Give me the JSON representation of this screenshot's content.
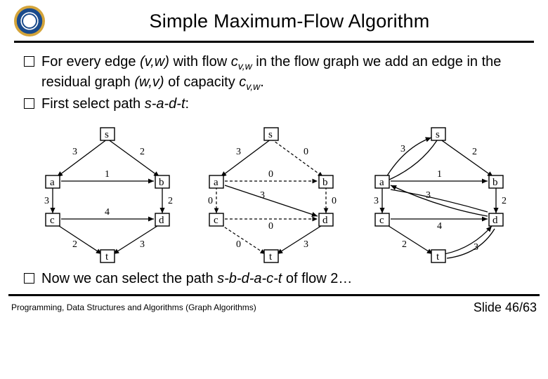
{
  "header": {
    "title": "Simple Maximum-Flow Algorithm"
  },
  "bullets": {
    "b1a": "For every edge ",
    "b1_vw": "(v,w)",
    "b1b": " with flow ",
    "b1_c1": "c",
    "b1_c1sub": "v,w",
    "b1c": " in the flow graph we add an edge in the residual graph ",
    "b1_wv": "(w,v)",
    "b1d": " of capacity ",
    "b1_c2": "c",
    "b1_c2sub": "v,w",
    "b1e": ".",
    "b2a": "First select path ",
    "b2_path": "s-a-d-t",
    "b2b": ":",
    "b3a": "Now we can select the path ",
    "b3_path": "s-b-d-a-c-t",
    "b3b": " of flow 2…"
  },
  "footer": {
    "left": "Programming, Data Structures and Algorithms  (Graph Algorithms)",
    "right_label": "Slide ",
    "right_page": "46/63"
  },
  "graphs": [
    {
      "id": "flow",
      "nodes": {
        "s": "s",
        "a": "a",
        "b": "b",
        "c": "c",
        "d": "d",
        "t": "t"
      },
      "edges": {
        "sa": "3",
        "sb": "2",
        "ab": "1",
        "ac": "3",
        "bd": "2",
        "cd": "4",
        "ct": "2",
        "dt": "3"
      },
      "dashed": []
    },
    {
      "id": "residual-dashed",
      "nodes": {
        "s": "s",
        "a": "a",
        "b": "b",
        "c": "c",
        "d": "d",
        "t": "t"
      },
      "edges": {
        "sa": "3",
        "sb": "0",
        "ab": "0",
        "ac": "0",
        "ad": "3",
        "bd": "0",
        "cd": "0",
        "ct": "0",
        "dt": "3"
      },
      "dashed": [
        "sb",
        "ab",
        "ac",
        "bd",
        "cd",
        "ct"
      ]
    },
    {
      "id": "residual-back",
      "nodes": {
        "s": "s",
        "a": "a",
        "b": "b",
        "c": "c",
        "d": "d",
        "t": "t"
      },
      "edges": {
        "as": "3",
        "sb": "2",
        "ab": "1",
        "ac": "3",
        "da": "3",
        "bd": "2",
        "cd": "4",
        "ct": "2",
        "td": "3"
      },
      "dashed": []
    }
  ]
}
